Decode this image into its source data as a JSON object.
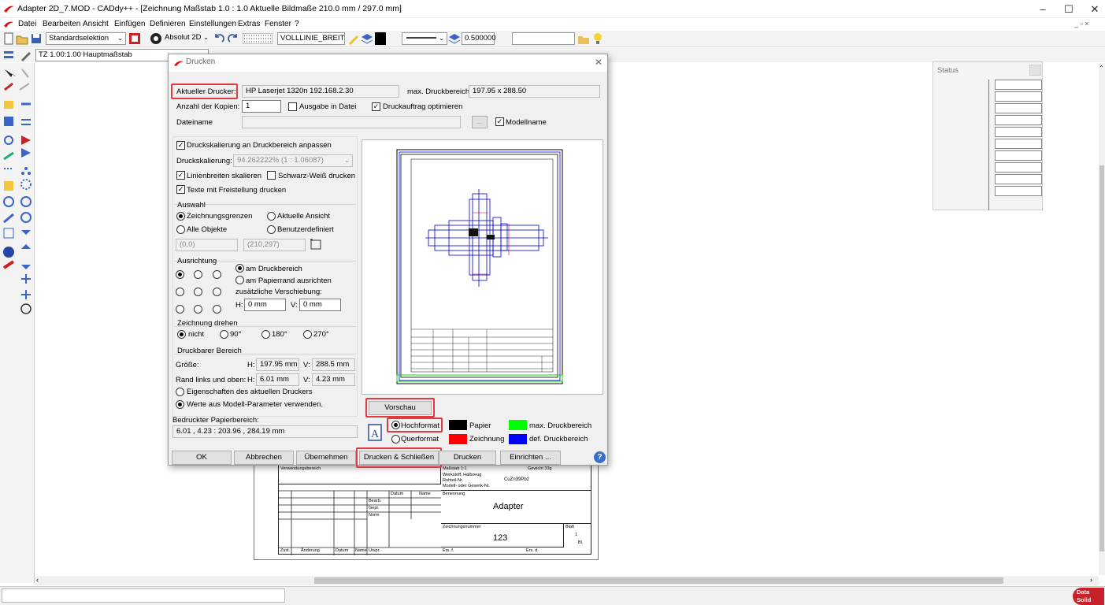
{
  "window": {
    "title": "Adapter 2D_7.MOD  -  CADdy++ - [Zeichnung   Maßstab 1.0 : 1.0   Aktuelle Bildmaße 210.0 mm / 297.0 mm]",
    "min": "–",
    "max": "☐",
    "close": "✕"
  },
  "menu": [
    "Datei",
    "Bearbeiten",
    "Ansicht",
    "Einfügen",
    "Definieren",
    "Einstellungen",
    "Extras",
    "Fenster",
    "?"
  ],
  "toolbar": {
    "selection": "Standardselektion",
    "coord_mode": "Absolut 2D",
    "linetype": "VOLLLINIE_BREIT",
    "linewidth": "0.500000",
    "scale_field": "TZ 1.00:1.00 Hauptmaßstab"
  },
  "status_panel": {
    "title": "Status"
  },
  "dialog": {
    "title": "Drucken",
    "printer_label": "Aktueller Drucker:",
    "printer_value": "HP Laserjet 1320n 192.168.2.30",
    "maxarea_label": "max. Druckbereich:",
    "maxarea_value": "197.95 x 288.50",
    "copies_label": "Anzahl der Kopien:",
    "copies_value": "1",
    "to_file_label": "Ausgabe in Datei",
    "optimize_label": "Druckauftrag optimieren",
    "filename_label": "Dateiname",
    "browse_label": "...",
    "modelname_label": "Modellname",
    "fit_scale_label": "Druckskalierung an Druckbereich anpassen",
    "scale_label": "Druckskalierung:",
    "scale_value": "94.262222%  (1 : 1.06087)",
    "scale_linewidths_label": "Linienbreiten skalieren",
    "bw_label": "Schwarz-Weiß drucken",
    "texts_label": "Texte mit Freistellung drucken",
    "auswahl_title": "Auswahl",
    "opt_drawing_limits": "Zeichnungsgrenzen",
    "opt_current_view": "Aktuelle Ansicht",
    "opt_all_objects": "Alle Objekte",
    "opt_user_defined": "Benutzerdefiniert",
    "coord_from": "(0,0)",
    "coord_to": "(210,297)",
    "ausrichtung_title": "Ausrichtung",
    "opt_print_area": "am Druckbereich",
    "opt_paper_edge": "am Papierrand ausrichten",
    "shift_label": "zusätzliche Verschiebung:",
    "h_label": "H:",
    "h_value": "0 mm",
    "v_label": "V:",
    "v_value": "0 mm",
    "rotate_title": "Zeichnung drehen",
    "rot_none": "nicht",
    "rot_90": "90°",
    "rot_180": "180°",
    "rot_270": "270°",
    "printable_title": "Druckbarer Bereich",
    "size_label": "Größe:",
    "size_h": "197.95 mm",
    "size_v": "288.5 mm",
    "margin_label": "Rand links und oben:",
    "margin_h": "6.01 mm",
    "margin_v": "4.23 mm",
    "opt_printer_props": "Eigenschaften des aktuellen Druckers",
    "opt_model_params": "Werte aus Modell-Parameter verwenden.",
    "paper_area_label": "Bedruckter Papierbereich:",
    "paper_area_value": "6.01 , 4.23 : 203.96 , 284.19 mm",
    "preview_button": "Vorschau",
    "portrait": "Hochformat",
    "landscape": "Querformat",
    "legend_paper": "Papier",
    "legend_drawing": "Zeichnung",
    "legend_max": "max. Druckbereich",
    "legend_def": "def. Druckbereich",
    "ok": "OK",
    "cancel": "Abbrechen",
    "apply": "Übernehmen",
    "print_close": "Drucken & Schließen",
    "print": "Drucken",
    "setup": "Einrichten ...",
    "help": "?",
    "colors": {
      "paper": "#000000",
      "drawing": "#ff0000",
      "max": "#00ff00",
      "def": "#0000ff",
      "highlight": "#e0393e"
    }
  },
  "titleblock": {
    "name": "Adapter",
    "number": "123",
    "datum": "Datum",
    "name_col": "Name",
    "bearb": "Bearb.",
    "gepr": "Gepr.",
    "norm": "Norm",
    "zust": "Zust.",
    "aenderung": "Änderung",
    "datum2": "Datum",
    "name2": "Name",
    "urspr": "Urspr.",
    "ers": "Ers. f.",
    "ers2": "Ers. d.",
    "verwendung": "Verwendungsbereich",
    "massstab": "Maßstab  1:1",
    "gewicht": "Gewicht  33g",
    "werkstoff": "Werkstoff, Halbzeug",
    "rohteil": "Rohteil-Nr.",
    "modell": "Modell- oder Gesenk-Nr.",
    "werkstoff_val": "CuZn39Pb2",
    "benennung": "Benennung",
    "zeichnr": "Zeichnungsnummer",
    "blatt": "Blatt",
    "blatt_val": "1",
    "bl": "Bl."
  },
  "brand": "Data Solid"
}
